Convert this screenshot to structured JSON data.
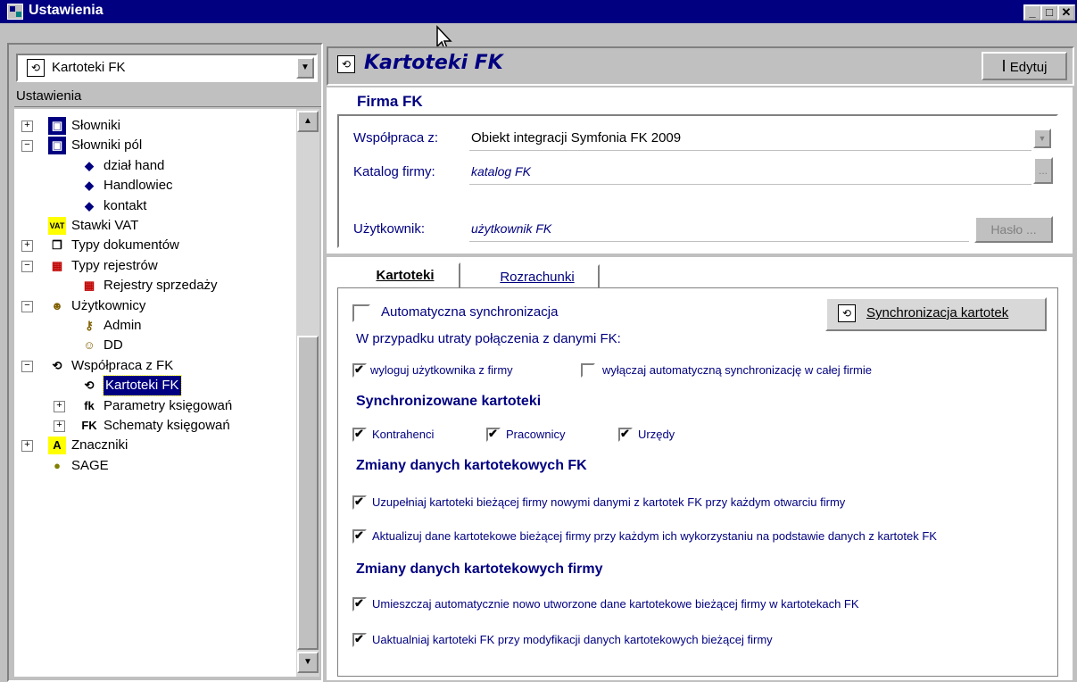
{
  "window": {
    "title": "Ustawienia",
    "buttons": {
      "minimize": "_",
      "maximize": "□",
      "close": "✕"
    }
  },
  "left": {
    "combo_value": "Kartoteki FK",
    "tree_header": "Ustawienia",
    "tree": [
      {
        "label": "Słowniki",
        "level": 0,
        "expander": "+",
        "icon": "dictionary-icon"
      },
      {
        "label": "Słowniki pól",
        "level": 0,
        "expander": "-",
        "icon": "dictionary-icon"
      },
      {
        "label": "dział hand",
        "level": 1,
        "icon": "book-icon"
      },
      {
        "label": "Handlowiec",
        "level": 1,
        "icon": "book-icon"
      },
      {
        "label": "kontakt",
        "level": 1,
        "icon": "book-icon"
      },
      {
        "label": "Stawki VAT",
        "level": 0,
        "icon": "vat-icon"
      },
      {
        "label": "Typy dokumentów",
        "level": 0,
        "expander": "+",
        "icon": "documents-icon"
      },
      {
        "label": "Typy rejestrów",
        "level": 0,
        "expander": "-",
        "icon": "register-icon"
      },
      {
        "label": "Rejestry sprzedaży",
        "level": 1,
        "icon": "register-icon"
      },
      {
        "label": "Użytkownicy",
        "level": 0,
        "expander": "-",
        "icon": "users-icon"
      },
      {
        "label": "Admin",
        "level": 1,
        "icon": "key-icon"
      },
      {
        "label": "DD",
        "level": 1,
        "icon": "user-icon"
      },
      {
        "label": "Współpraca z FK",
        "level": 0,
        "expander": "-",
        "icon": "sync-icon"
      },
      {
        "label": "Kartoteki FK",
        "level": 1,
        "icon": "sync-icon",
        "selected": true
      },
      {
        "label": "Parametry księgowań",
        "level": 1,
        "expander": "+",
        "icon": "fk-italic-icon"
      },
      {
        "label": "Schematy księgowań",
        "level": 1,
        "expander": "+",
        "icon": "fk-bold-icon"
      },
      {
        "label": "Znaczniki",
        "level": 0,
        "expander": "+",
        "icon": "marker-icon"
      },
      {
        "label": "SAGE",
        "level": 0,
        "icon": "sage-icon"
      }
    ]
  },
  "right": {
    "title": "Kartoteki FK",
    "edit_button": "Edytuj",
    "firma": {
      "section_title": "Firma FK",
      "wspolpraca_label": "Współpraca z:",
      "wspolpraca_value": "Obiekt integracji Symfonia FK 2009",
      "katalog_label": "Katalog firmy:",
      "katalog_value": "katalog FK",
      "browse_button": "...",
      "uzytkownik_label": "Użytkownik:",
      "uzytkownik_value": "użytkownik FK",
      "haslo_button": "Hasło ..."
    },
    "tabs": [
      {
        "label": "Kartoteki",
        "active": true
      },
      {
        "label": "Rozrachunki",
        "active": false
      }
    ],
    "kartoteki": {
      "auto_sync": {
        "label": "Automatyczna synchronizacja",
        "checked": false
      },
      "sync_button": "Synchronizacja kartotek",
      "lost_connection_label": "W przypadku utraty połączenia z danymi FK:",
      "logout_user": {
        "label": "wyloguj użytkownika z firmy",
        "checked": true
      },
      "disable_sync": {
        "label": "wyłączaj automatyczną synchronizację w całej firmie",
        "checked": false
      },
      "synced_title": "Synchronizowane kartoteki",
      "synced": [
        {
          "label": "Kontrahenci",
          "checked": true
        },
        {
          "label": "Pracownicy",
          "checked": true
        },
        {
          "label": "Urzędy",
          "checked": true
        }
      ],
      "fk_changes_title": "Zmiany danych kartotekowych FK",
      "fk_changes": [
        {
          "label": "Uzupełniaj kartoteki bieżącej firmy nowymi danymi z kartotek FK przy każdym otwarciu firmy",
          "checked": true
        },
        {
          "label": "Aktualizuj dane kartotekowe bieżącej firmy przy każdym ich wykorzystaniu na podstawie danych z kartotek FK",
          "checked": true
        }
      ],
      "firm_changes_title": "Zmiany danych kartotekowych firmy",
      "firm_changes": [
        {
          "label": "Umieszczaj automatycznie nowo utworzone dane kartotekowe bieżącej firmy w kartotekach FK",
          "checked": true
        },
        {
          "label": "Uaktualniaj kartoteki FK przy modyfikacji danych kartotekowych bieżącej firmy",
          "checked": true
        }
      ]
    }
  }
}
